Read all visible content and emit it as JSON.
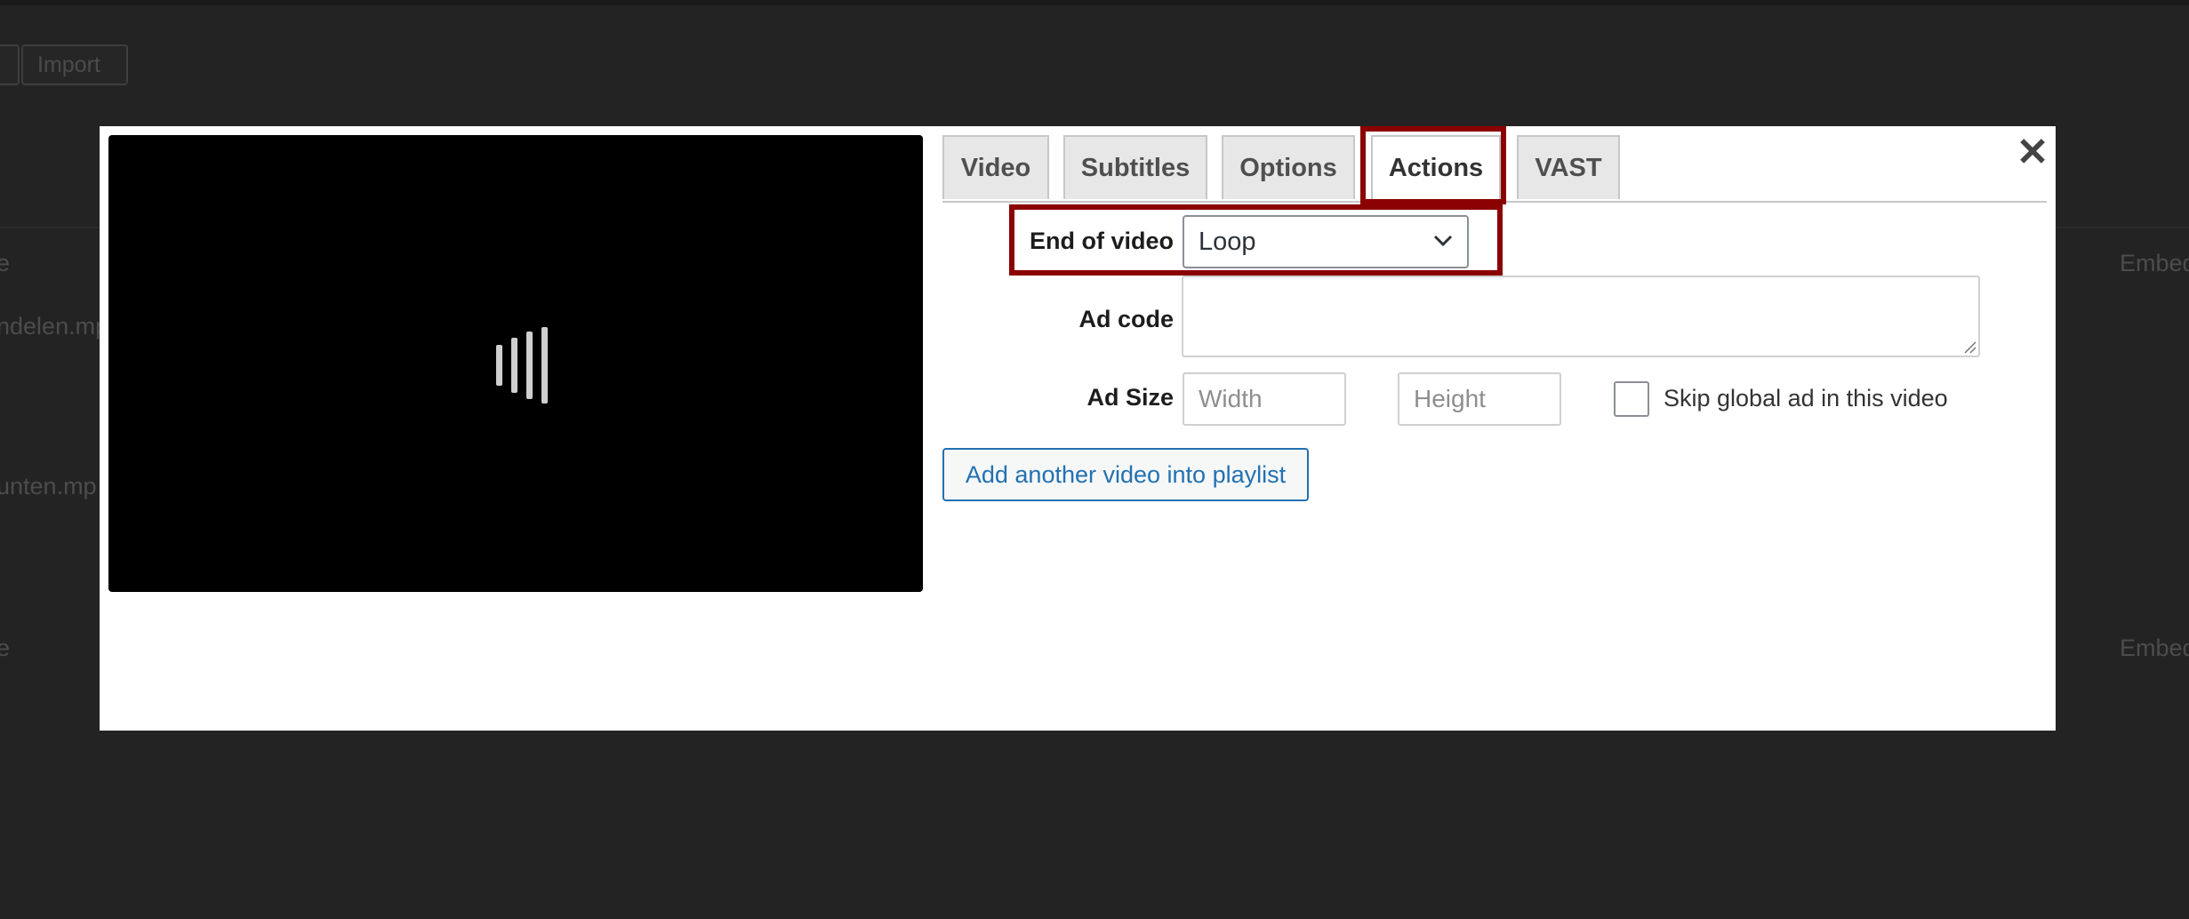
{
  "background": {
    "button_1_label": "",
    "import_label": "Import",
    "row_texts": [
      "e",
      "ndelen.mp",
      "unten.mp",
      "e"
    ],
    "right_texts": [
      "Embed",
      "Embed"
    ]
  },
  "modal": {
    "close_icon": "✕",
    "tabs": [
      {
        "label": "Video"
      },
      {
        "label": "Subtitles"
      },
      {
        "label": "Options"
      },
      {
        "label": "Actions"
      },
      {
        "label": "VAST"
      }
    ],
    "active_tab": "Actions",
    "form": {
      "end_of_video_label": "End of video",
      "end_of_video_value": "Loop",
      "ad_code_label": "Ad code",
      "ad_code_value": "",
      "ad_size_label": "Ad Size",
      "width_placeholder": "Width",
      "height_placeholder": "Height",
      "skip_global_ad_label": "Skip global ad in this video",
      "skip_global_ad_checked": false
    },
    "add_video_button": "Add another video into playlist"
  },
  "colors": {
    "highlight": "#8b0000",
    "link_blue": "#2271b1",
    "backdrop": "#232323"
  }
}
